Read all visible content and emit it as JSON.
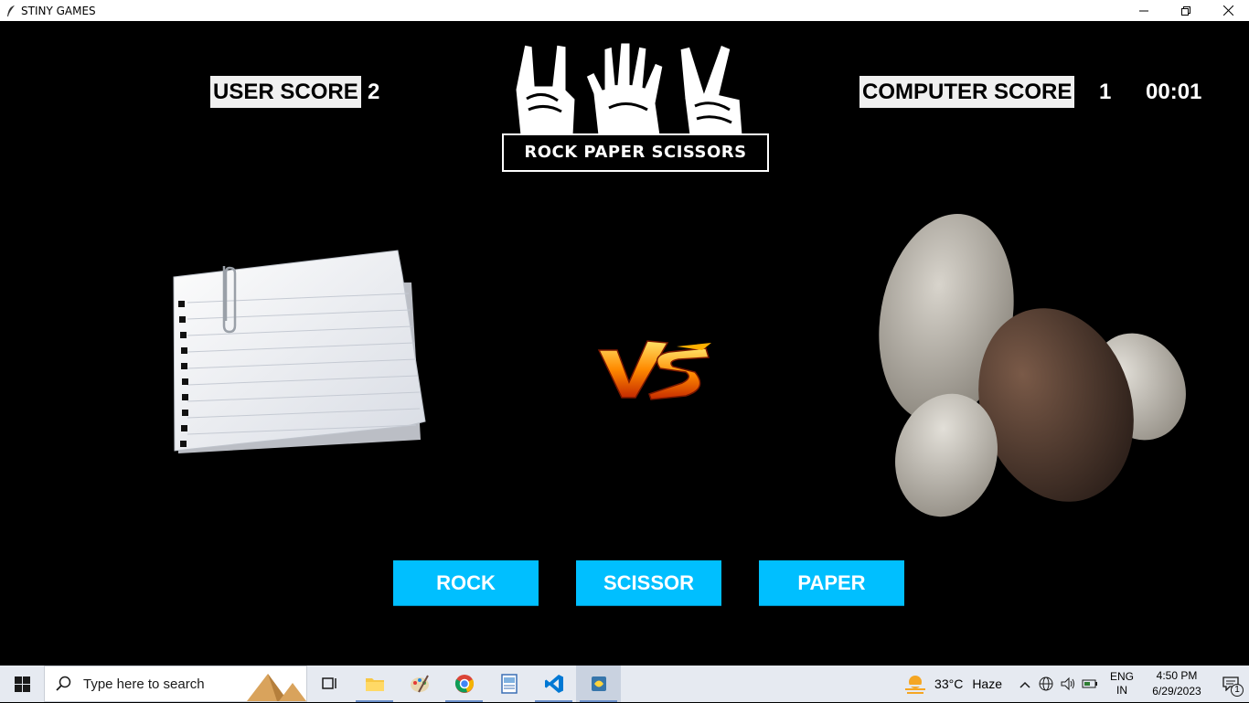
{
  "window": {
    "title": "STINY GAMES"
  },
  "scores": {
    "user_label": "USER SCORE",
    "user_value": "2",
    "computer_label": "COMPUTER SCORE",
    "computer_value": "1",
    "timer": "00:01"
  },
  "logo": {
    "text": "ROCK PAPER SCISSORS"
  },
  "arena": {
    "user_choice": "paper",
    "computer_choice": "rock",
    "vs_text": "VS"
  },
  "buttons": {
    "rock": "ROCK",
    "scissor": "SCISSOR",
    "paper": "PAPER"
  },
  "taskbar": {
    "search_placeholder": "Type here to search",
    "weather_temp": "33°C",
    "weather_desc": "Haze",
    "lang_top": "ENG",
    "lang_bottom": "IN",
    "time": "4:50 PM",
    "date": "6/29/2023",
    "notification_count": "1"
  },
  "colors": {
    "background": "#000000",
    "button": "#00bfff",
    "label_bg": "#f0f0f0",
    "taskbar": "#e6eaf1"
  }
}
